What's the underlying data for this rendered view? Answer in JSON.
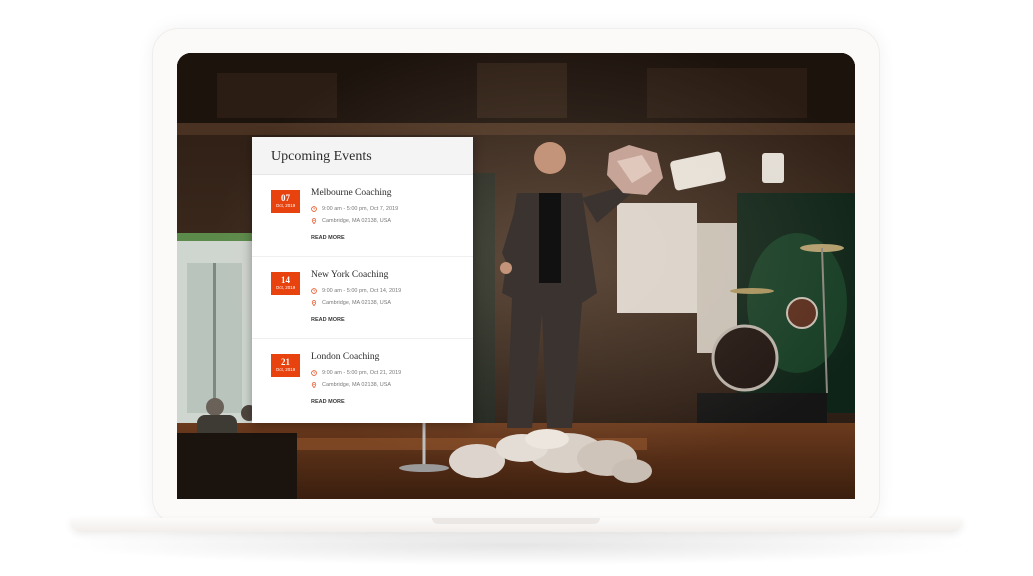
{
  "panel": {
    "title": "Upcoming Events"
  },
  "events": [
    {
      "day": "07",
      "month": "Oct, 2019",
      "title": "Melbourne Coaching",
      "time": "9:00 am - 5:00 pm, Oct 7, 2019",
      "location": "Cambridge, MA 02138, USA",
      "read_more": "READ MORE"
    },
    {
      "day": "14",
      "month": "Oct, 2019",
      "title": "New York Coaching",
      "time": "9:00 am - 5:00 pm, Oct 14, 2019",
      "location": "Cambridge, MA 02138, USA",
      "read_more": "READ MORE"
    },
    {
      "day": "21",
      "month": "Oct, 2019",
      "title": "London Coaching",
      "time": "9:00 am - 5:00 pm, Oct 21, 2019",
      "location": "Cambridge, MA 02138, USA",
      "read_more": "READ MORE"
    }
  ],
  "icons": {
    "time": "clock-icon",
    "location": "map-pin-icon"
  },
  "colors": {
    "accent": "#e8420f",
    "panel_bg": "#ffffff",
    "header_bg": "#f4f4f4"
  }
}
